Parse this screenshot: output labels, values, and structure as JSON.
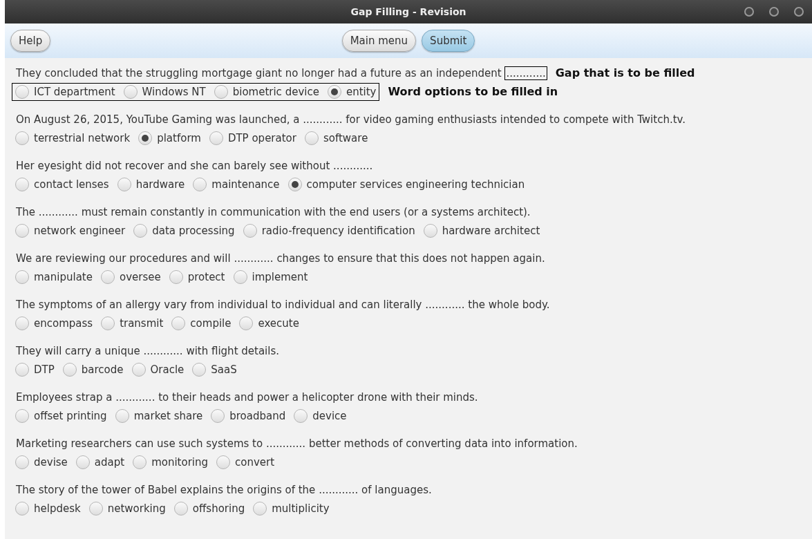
{
  "window": {
    "title": "Gap Filling - Revision"
  },
  "toolbar": {
    "help": "Help",
    "buttons": [
      {
        "label": "Main menu",
        "selected": false
      },
      {
        "label": "Submit",
        "selected": true
      }
    ]
  },
  "questions": [
    {
      "before": "They concluded that the struggling mortgage giant no longer had a future as an independent",
      "gap": "............",
      "annotation": {
        "gap_note": "Gap that is to be filled",
        "options_note": "Word options to be filled in"
      },
      "options": [
        {
          "label": "ICT department",
          "selected": false
        },
        {
          "label": "Windows NT",
          "selected": false
        },
        {
          "label": "biometric device",
          "selected": false
        },
        {
          "label": "entity",
          "selected": true
        }
      ]
    },
    {
      "before": "On August 26, 2015, YouTube Gaming was launched, a",
      "gap": "............",
      "after": "for video gaming enthusiasts intended to compete with Twitch.tv.",
      "options": [
        {
          "label": "terrestrial network",
          "selected": false
        },
        {
          "label": "platform",
          "selected": true
        },
        {
          "label": "DTP operator",
          "selected": false
        },
        {
          "label": "software",
          "selected": false
        }
      ]
    },
    {
      "before": "Her eyesight did not recover and she can barely see without",
      "gap": "............",
      "options": [
        {
          "label": "contact lenses",
          "selected": false
        },
        {
          "label": "hardware",
          "selected": false
        },
        {
          "label": "maintenance",
          "selected": false
        },
        {
          "label": "computer services engineering technician",
          "selected": true
        }
      ]
    },
    {
      "before": "The",
      "gap": "............",
      "after": "must remain constantly in communication with the end users (or a systems architect).",
      "options": [
        {
          "label": "network engineer",
          "selected": false
        },
        {
          "label": "data processing",
          "selected": false
        },
        {
          "label": "radio-frequency identification",
          "selected": false
        },
        {
          "label": "hardware architect",
          "selected": false
        }
      ]
    },
    {
      "before": "We are reviewing our procedures and will",
      "gap": "............",
      "after": "changes to ensure that this does not happen again.",
      "options": [
        {
          "label": "manipulate",
          "selected": false
        },
        {
          "label": "oversee",
          "selected": false
        },
        {
          "label": "protect",
          "selected": false
        },
        {
          "label": "implement",
          "selected": false
        }
      ]
    },
    {
      "before": "The symptoms of an allergy vary from individual to individual and can literally",
      "gap": "............",
      "after": "the whole body.",
      "options": [
        {
          "label": "encompass",
          "selected": false
        },
        {
          "label": "transmit",
          "selected": false
        },
        {
          "label": "compile",
          "selected": false
        },
        {
          "label": "execute",
          "selected": false
        }
      ]
    },
    {
      "before": "They will carry a unique",
      "gap": "............",
      "after": "with flight details.",
      "options": [
        {
          "label": "DTP",
          "selected": false
        },
        {
          "label": "barcode",
          "selected": false
        },
        {
          "label": "Oracle",
          "selected": false
        },
        {
          "label": "SaaS",
          "selected": false
        }
      ]
    },
    {
      "before": "Employees strap a",
      "gap": "............",
      "after": "to their heads and power a helicopter drone with their minds.",
      "options": [
        {
          "label": "offset printing",
          "selected": false
        },
        {
          "label": "market share",
          "selected": false
        },
        {
          "label": "broadband",
          "selected": false
        },
        {
          "label": "device",
          "selected": false
        }
      ]
    },
    {
      "before": "Marketing researchers can use such systems to",
      "gap": "............",
      "after": "better methods of converting data into information.",
      "options": [
        {
          "label": "devise",
          "selected": false
        },
        {
          "label": "adapt",
          "selected": false
        },
        {
          "label": "monitoring",
          "selected": false
        },
        {
          "label": "convert",
          "selected": false
        }
      ]
    },
    {
      "before": "The story of the tower of Babel explains the origins of the",
      "gap": "............",
      "after": "of languages.",
      "options": [
        {
          "label": "helpdesk",
          "selected": false
        },
        {
          "label": "networking",
          "selected": false
        },
        {
          "label": "offshoring",
          "selected": false
        },
        {
          "label": "multiplicity",
          "selected": false
        }
      ]
    }
  ]
}
